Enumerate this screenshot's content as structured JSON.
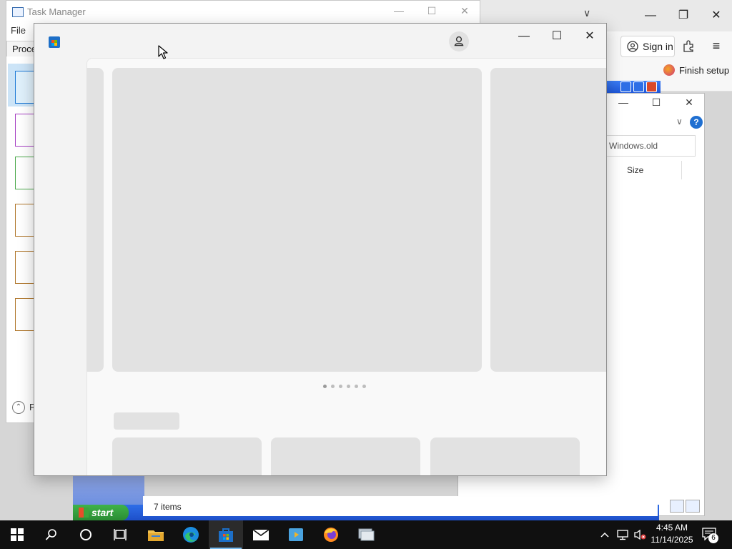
{
  "edge": {
    "signin_label": "Sign in",
    "finish_setup_label": "Finish setup"
  },
  "explorer": {
    "address_value": "Windows.old",
    "column_size": "Size",
    "status_items": "7 items"
  },
  "taskmgr": {
    "title": "Task Manager",
    "menu_file": "File",
    "tab_processes": "Proce",
    "fewer_details_label": "F",
    "graph_colors": [
      "#1f7ad6",
      "#a63fc3",
      "#4aa84a",
      "#b0762a",
      "#b0762a",
      "#b0762a"
    ]
  },
  "xp": {
    "start_label": "start"
  },
  "store": {
    "carousel_dot_count": 6,
    "carousel_active_dot": 0
  },
  "taskbar": {
    "notification_count": "6",
    "clock_time": "4:45 AM",
    "clock_date": "11/14/2025",
    "apps": [
      {
        "name": "file-explorer-icon"
      },
      {
        "name": "edge-icon"
      },
      {
        "name": "store-icon",
        "active": true
      },
      {
        "name": "mail-icon"
      },
      {
        "name": "media-player-icon"
      },
      {
        "name": "firefox-icon"
      },
      {
        "name": "network-app-icon"
      }
    ]
  }
}
